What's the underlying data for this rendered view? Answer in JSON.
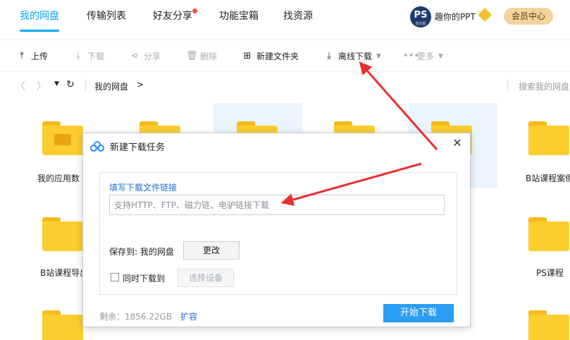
{
  "nav": {
    "tabs": [
      "我的网盘",
      "传输列表",
      "好友分享",
      "功能宝箱",
      "找资源"
    ],
    "active_index": 0,
    "user_name": "趣你的PPT",
    "avatar_text": "PS",
    "avatar_sub": "向天歌",
    "vip_button": "会员中心",
    "accent": "#06a7ff"
  },
  "toolbar": {
    "upload": "上传",
    "download": "下载",
    "share": "分享",
    "delete": "删除",
    "new_folder": "新建文件夹",
    "offline_download": "离线下载",
    "more": "更多"
  },
  "path": {
    "crumb": "我的网盘",
    "arrow": ">",
    "search_placeholder": "搜索我的网盘"
  },
  "folders": [
    {
      "label": "我的应用数"
    },
    {
      "label": ""
    },
    {
      "label": ""
    },
    {
      "label": ""
    },
    {
      "label": ""
    },
    {
      "label": "B站课程案例"
    },
    {
      "label": "B站课程导出"
    },
    {
      "label": "PS课程"
    }
  ],
  "dialog": {
    "title": "新建下载任务",
    "link_label": "填写下载文件链接",
    "url_placeholder": "支持HTTP、FTP、磁力链、电驴链接下载",
    "save_to": "保存到: 我的网盘",
    "change_button": "更改",
    "sync_label": "同时下载到",
    "device_button": "选择设备",
    "remaining_label": "剩余：1856.22GB",
    "expand_link": "扩容",
    "start_button": "开始下载"
  },
  "colors": {
    "folder": "#fbcd2e",
    "primary_button": "#2a9df4",
    "arrow": "#e8312f"
  }
}
